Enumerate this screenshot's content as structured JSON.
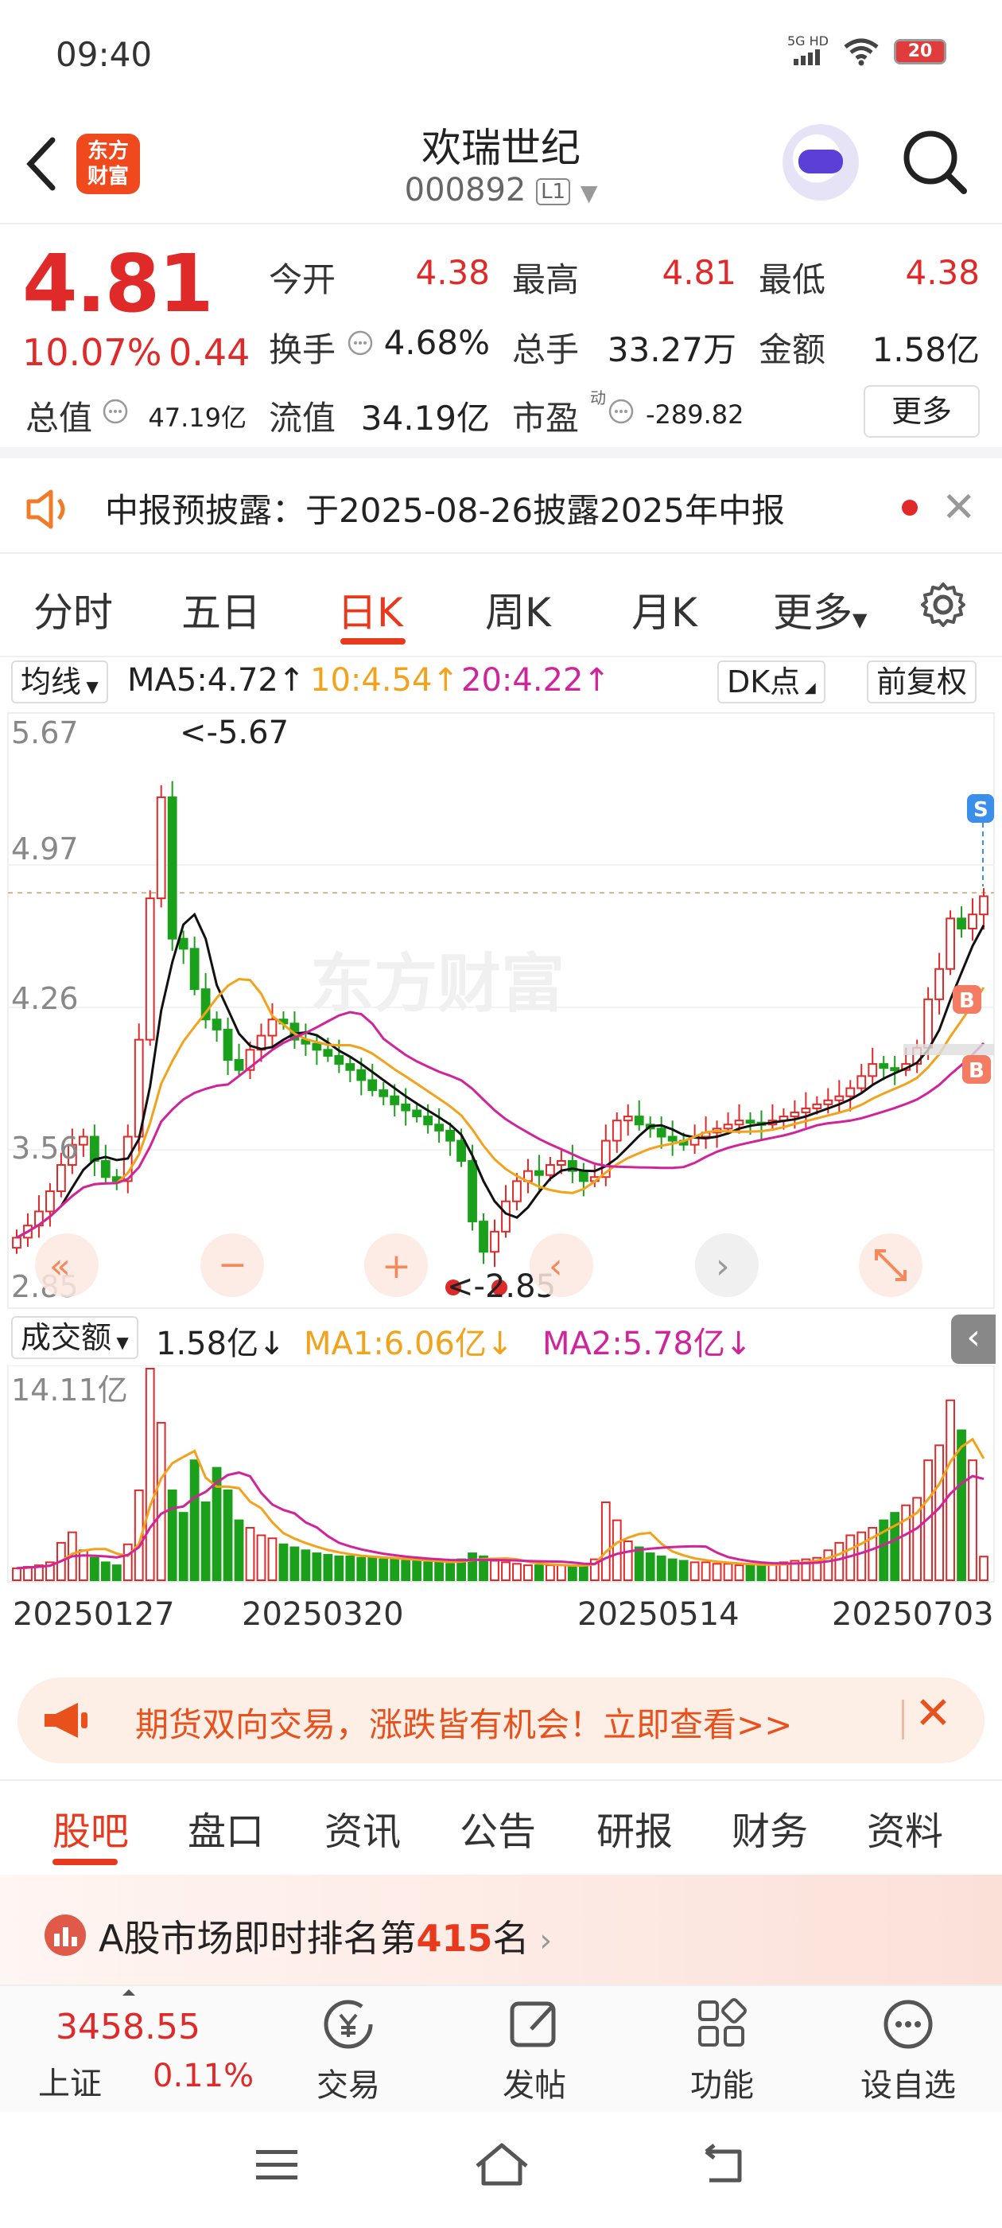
{
  "status_bar": {
    "time": "09:40",
    "network": "5G HD",
    "battery": "20"
  },
  "header": {
    "title": "欢瑞世纪",
    "code": "000892",
    "level": "L1",
    "logo_line1": "东方",
    "logo_line2": "财富"
  },
  "quote": {
    "price": "4.81",
    "change_pct": "10.07%",
    "change": "0.44",
    "open_label": "今开",
    "open": "4.38",
    "high_label": "最高",
    "high": "4.81",
    "low_label": "最低",
    "low": "4.38",
    "turnover_label": "换手",
    "turnover": "4.68%",
    "volume_label": "总手",
    "volume": "33.27万",
    "amount_label": "金额",
    "amount": "1.58亿",
    "mktcap_label": "总值",
    "mktcap": "47.19亿",
    "float_label": "流值",
    "float_cap": "34.19亿",
    "pe_label": "市盈",
    "pe_sup": "动",
    "pe": "-289.82",
    "more_label": "更多"
  },
  "notice": {
    "text": "中报预披露：于2025-08-26披露2025年中报"
  },
  "chart_tabs": [
    "分时",
    "五日",
    "日K",
    "周K",
    "月K",
    "更多"
  ],
  "chart_tabs_active": "日K",
  "indicator": {
    "ma_label": "均线",
    "ma5": "MA5:4.72↑",
    "ma10": "10:4.54↑",
    "ma20": "20:4.22↑",
    "dk_label": "DK点",
    "adjust_label": "前复权",
    "y_ticks": [
      "5.67",
      "4.97",
      "4.26",
      "3.56",
      "2.85"
    ],
    "max_marker": "<-5.67",
    "min_marker": "<-2.85",
    "buy_marker": "B",
    "sell_marker": "S",
    "watermark": "东方财富"
  },
  "volume_panel": {
    "label": "成交额",
    "current": "1.58亿↓",
    "ma1": "MA1:6.06亿↓",
    "ma2": "MA2:5.78亿↓",
    "y_max": "14.11亿",
    "dates": [
      "20250127",
      "20250320",
      "20250514",
      "20250703"
    ]
  },
  "colors": {
    "up": "#e02a2a",
    "down": "#1aa01a",
    "ma5": "#111111",
    "ma10": "#f2a31b",
    "ma20": "#d0249a",
    "accent": "#e8391d"
  },
  "chart_data": {
    "type": "candlestick",
    "title": "",
    "ylim": [
      2.85,
      5.67
    ],
    "x_ticks": [
      "20250127",
      "20250320",
      "20250514",
      "20250703"
    ],
    "close": [
      3.12,
      3.18,
      3.25,
      3.35,
      3.48,
      3.58,
      3.62,
      3.5,
      3.42,
      3.4,
      3.62,
      4.1,
      4.8,
      5.3,
      4.6,
      4.55,
      4.35,
      4.2,
      4.15,
      4.0,
      3.95,
      4.05,
      4.12,
      4.2,
      4.18,
      4.1,
      4.08,
      4.05,
      4.02,
      3.98,
      3.95,
      3.9,
      3.85,
      3.82,
      3.78,
      3.75,
      3.72,
      3.68,
      3.65,
      3.6,
      3.5,
      3.2,
      3.05,
      3.15,
      3.3,
      3.4,
      3.45,
      3.43,
      3.48,
      3.5,
      3.45,
      3.4,
      3.42,
      3.6,
      3.7,
      3.72,
      3.68,
      3.66,
      3.62,
      3.6,
      3.58,
      3.62,
      3.64,
      3.66,
      3.68,
      3.7,
      3.69,
      3.68,
      3.7,
      3.72,
      3.74,
      3.76,
      3.78,
      3.8,
      3.82,
      3.86,
      3.92,
      3.98,
      3.96,
      3.95,
      3.98,
      4.06,
      4.3,
      4.45,
      4.7,
      4.65,
      4.72,
      4.81
    ],
    "ma5_last": 4.72,
    "ma10_last": 4.54,
    "ma20_last": 4.22,
    "volume_max_yi": 14.11,
    "volume_yi": [
      0.8,
      0.9,
      1.0,
      1.2,
      2.5,
      3.2,
      2.0,
      1.5,
      1.2,
      1.0,
      2.4,
      6.0,
      14.11,
      10.5,
      6.0,
      4.5,
      8.0,
      5.2,
      7.5,
      6.0,
      4.0,
      3.5,
      3.0,
      2.8,
      2.4,
      2.2,
      2.0,
      1.8,
      1.7,
      1.6,
      1.6,
      1.5,
      1.5,
      1.4,
      1.4,
      1.3,
      1.3,
      1.2,
      1.2,
      1.1,
      1.4,
      1.8,
      1.6,
      1.3,
      1.2,
      1.1,
      1.0,
      1.0,
      1.0,
      1.0,
      0.9,
      1.0,
      1.4,
      5.2,
      4.0,
      2.6,
      2.2,
      1.8,
      1.6,
      1.4,
      1.3,
      1.2,
      1.2,
      1.1,
      1.1,
      1.0,
      1.0,
      1.0,
      1.1,
      1.2,
      1.3,
      1.4,
      1.5,
      2.0,
      2.5,
      3.0,
      3.2,
      3.5,
      4.0,
      4.5,
      5.0,
      5.5,
      8.0,
      9.0,
      12.0,
      10.0,
      8.0,
      1.58
    ]
  },
  "promo": {
    "text": "期货双向交易，涨跌皆有机会！立即查看>>"
  },
  "sub_tabs": [
    "股吧",
    "盘口",
    "资讯",
    "公告",
    "研报",
    "财务",
    "资料"
  ],
  "rank": {
    "prefix": "A股市场即时排名第",
    "rank": "415",
    "suffix": "名"
  },
  "bottom_bar": {
    "index_value": "3458.55",
    "index_name": "上证",
    "index_pct": "0.11%",
    "trade": "交易",
    "post": "发帖",
    "function": "功能",
    "watchlist": "设自选"
  }
}
